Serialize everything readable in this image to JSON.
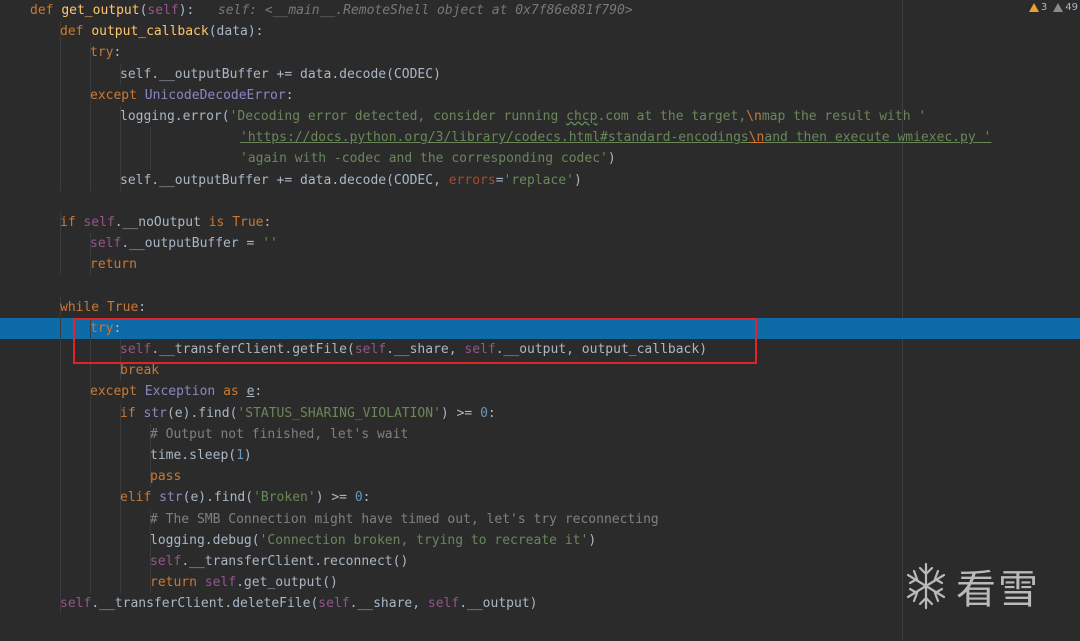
{
  "editor": {
    "lines": [
      {
        "indent": 0,
        "tokens": [
          [
            "kw",
            "def "
          ],
          [
            "fn",
            "get_output"
          ],
          [
            "",
            "("
          ],
          [
            "self",
            "self"
          ],
          [
            "",
            "):   "
          ],
          [
            "hint",
            "self: <__main__.RemoteShell object at 0x7f86e881f790>"
          ]
        ]
      },
      {
        "indent": 1,
        "tokens": [
          [
            "kw",
            "def "
          ],
          [
            "fn",
            "output_callback"
          ],
          [
            "",
            "(data):"
          ]
        ]
      },
      {
        "indent": 2,
        "tokens": [
          [
            "kw",
            "try"
          ],
          [
            "",
            ":"
          ]
        ]
      },
      {
        "indent": 3,
        "tokens": [
          [
            "",
            "self.__outputBuffer += data.decode(CODEC)"
          ]
        ]
      },
      {
        "indent": 2,
        "tokens": [
          [
            "kw",
            "except "
          ],
          [
            "bi",
            "UnicodeDecodeError"
          ],
          [
            "",
            ":"
          ]
        ]
      },
      {
        "indent": 3,
        "tokens": [
          [
            "",
            "logging.error("
          ],
          [
            "str",
            "'Decoding error detected, consider running "
          ],
          [
            "str typo",
            "chcp"
          ],
          [
            "str",
            ".com at the target,"
          ],
          [
            "esc",
            "\\n"
          ],
          [
            "str",
            "map the result with '"
          ]
        ]
      },
      {
        "indent": 7,
        "tokens": [
          [
            "str ul",
            "'https://docs.python.org/3/library/codecs.html#standard-encodings"
          ],
          [
            "esc ul",
            "\\n"
          ],
          [
            "str ul",
            "and then execute wmiexec.py '"
          ]
        ]
      },
      {
        "indent": 7,
        "tokens": [
          [
            "str",
            "'again with -codec and the corresponding codec'"
          ],
          [
            "",
            ")"
          ]
        ]
      },
      {
        "indent": 3,
        "tokens": [
          [
            "",
            "self.__outputBuffer += data.decode(CODEC, "
          ],
          [
            "param",
            "errors"
          ],
          [
            "",
            "="
          ],
          [
            "str",
            "'replace'"
          ],
          [
            "",
            ")"
          ]
        ]
      },
      {
        "indent": 0,
        "tokens": []
      },
      {
        "indent": 1,
        "tokens": [
          [
            "kw",
            "if "
          ],
          [
            "self",
            "self"
          ],
          [
            "",
            ".__noOutput "
          ],
          [
            "kw",
            "is True"
          ],
          [
            "",
            ":"
          ]
        ]
      },
      {
        "indent": 2,
        "tokens": [
          [
            "self",
            "self"
          ],
          [
            "",
            ".__outputBuffer = "
          ],
          [
            "str",
            "''"
          ]
        ]
      },
      {
        "indent": 2,
        "tokens": [
          [
            "kw",
            "return"
          ]
        ]
      },
      {
        "indent": 0,
        "tokens": []
      },
      {
        "indent": 1,
        "tokens": [
          [
            "kw",
            "while True"
          ],
          [
            "",
            ":"
          ]
        ]
      },
      {
        "indent": 2,
        "exec": true,
        "tokens": [
          [
            "kw",
            "try"
          ],
          [
            "",
            ":"
          ]
        ]
      },
      {
        "indent": 3,
        "tokens": [
          [
            "self",
            "self"
          ],
          [
            "",
            ".__transferClient.getFile("
          ],
          [
            "self",
            "self"
          ],
          [
            "",
            ".__share, "
          ],
          [
            "self",
            "self"
          ],
          [
            "",
            ".__output, output_callback)"
          ]
        ]
      },
      {
        "indent": 3,
        "tokens": [
          [
            "kw",
            "break"
          ]
        ]
      },
      {
        "indent": 2,
        "tokens": [
          [
            "kw",
            "except "
          ],
          [
            "bi",
            "Exception "
          ],
          [
            "kw",
            "as "
          ],
          [
            "ul",
            "e"
          ],
          [
            "",
            ":"
          ]
        ]
      },
      {
        "indent": 3,
        "tokens": [
          [
            "kw",
            "if "
          ],
          [
            "bi",
            "str"
          ],
          [
            "",
            "(e).find("
          ],
          [
            "str",
            "'STATUS_SHARING_VIOLATION'"
          ],
          [
            "",
            ") >= "
          ],
          [
            "num",
            "0"
          ],
          [
            "",
            ":"
          ]
        ]
      },
      {
        "indent": 4,
        "tokens": [
          [
            "cm",
            "# Output not finished, let's wait"
          ]
        ]
      },
      {
        "indent": 4,
        "tokens": [
          [
            "",
            "time.sleep("
          ],
          [
            "num",
            "1"
          ],
          [
            "",
            ")"
          ]
        ]
      },
      {
        "indent": 4,
        "tokens": [
          [
            "kw",
            "pass"
          ]
        ]
      },
      {
        "indent": 3,
        "tokens": [
          [
            "kw",
            "elif "
          ],
          [
            "bi",
            "str"
          ],
          [
            "",
            "(e).find("
          ],
          [
            "str",
            "'Broken'"
          ],
          [
            "",
            ") >= "
          ],
          [
            "num",
            "0"
          ],
          [
            "",
            ":"
          ]
        ]
      },
      {
        "indent": 4,
        "tokens": [
          [
            "cm",
            "# The SMB Connection might have timed out, let's try reconnecting"
          ]
        ]
      },
      {
        "indent": 4,
        "tokens": [
          [
            "",
            "logging.debug("
          ],
          [
            "str",
            "'Connection broken, trying to recreate it'"
          ],
          [
            "",
            ")"
          ]
        ]
      },
      {
        "indent": 4,
        "tokens": [
          [
            "self",
            "self"
          ],
          [
            "",
            ".__transferClient.reconnect()"
          ]
        ]
      },
      {
        "indent": 4,
        "tokens": [
          [
            "kw",
            "return "
          ],
          [
            "self",
            "self"
          ],
          [
            "",
            ".get_output()"
          ]
        ]
      },
      {
        "indent": 1,
        "tokens": [
          [
            "self",
            "self"
          ],
          [
            "",
            ".__transferClient.deleteFile("
          ],
          [
            "self",
            "self"
          ],
          [
            "",
            ".__share, "
          ],
          [
            "self",
            "self"
          ],
          [
            "",
            ".__output)"
          ]
        ]
      }
    ]
  },
  "inspections": {
    "warnings_count": "3",
    "weak_warnings_count": "49",
    "warning_color": "#e6a133"
  },
  "watermark": {
    "text": "看雪",
    "icon": "snowflake-icon"
  },
  "colors": {
    "execution_line": "#0e6ba8",
    "highlight_box": "#e0242b",
    "background": "#2b2b2b"
  }
}
